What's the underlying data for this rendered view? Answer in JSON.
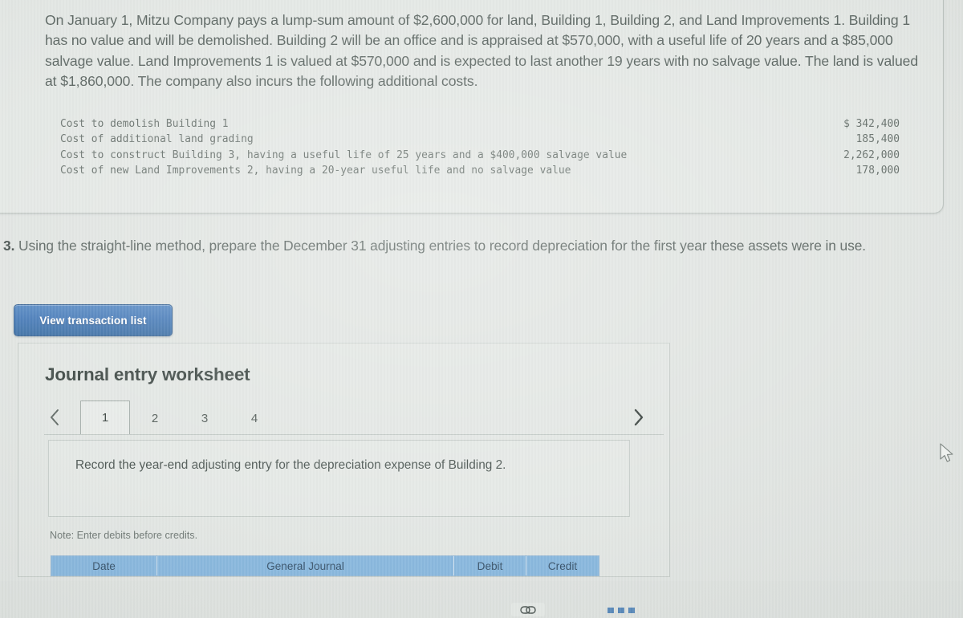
{
  "problem": {
    "paragraph": "On January 1, Mitzu Company pays a lump-sum amount of $2,600,000 for land, Building 1, Building 2, and Land Improvements 1. Building 1 has no value and will be demolished. Building 2 will be an office and is appraised at $570,000, with a useful life of 20 years and a $85,000 salvage value. Land Improvements 1 is valued at $570,000 and is expected to last another 19 years with no salvage value. The land is valued at $1,860,000. The company also incurs the following additional costs.",
    "costs": [
      {
        "label": "Cost to demolish Building 1",
        "amount": "$ 342,400"
      },
      {
        "label": "Cost of additional land grading",
        "amount": "185,400"
      },
      {
        "label": "Cost to construct Building 3, having a useful life of 25 years and a $400,000 salvage value",
        "amount": "2,262,000"
      },
      {
        "label": "Cost of new Land Improvements 2, having a 20-year useful life and no salvage value",
        "amount": "178,000"
      }
    ]
  },
  "question": {
    "number": "3.",
    "text": "Using the straight-line method, prepare the December 31 adjusting entries to record depreciation for the first year these assets were in use."
  },
  "toolbar": {
    "view_transaction_list_label": "View transaction list"
  },
  "worksheet": {
    "title": "Journal entry worksheet",
    "prev_label": "‹",
    "next_label": "›",
    "tabs": [
      {
        "label": "1",
        "active": true
      },
      {
        "label": "2",
        "active": false
      },
      {
        "label": "3",
        "active": false
      },
      {
        "label": "4",
        "active": false
      }
    ],
    "instruction": "Record the year-end adjusting entry for the depreciation expense of Building 2.",
    "note": "Note: Enter debits before credits.",
    "table_headers": {
      "date": "Date",
      "general_journal": "General Journal",
      "debit": "Debit",
      "credit": "Credit"
    }
  },
  "footer": {
    "link_icon_glyph": "∞"
  },
  "colors": {
    "page_background": "#dfe3e0",
    "panel_background": "#e2e6e3",
    "button_blue": "#3c73b4",
    "table_header_blue": "#7fb2dc",
    "body_text": "#4f5a56"
  }
}
